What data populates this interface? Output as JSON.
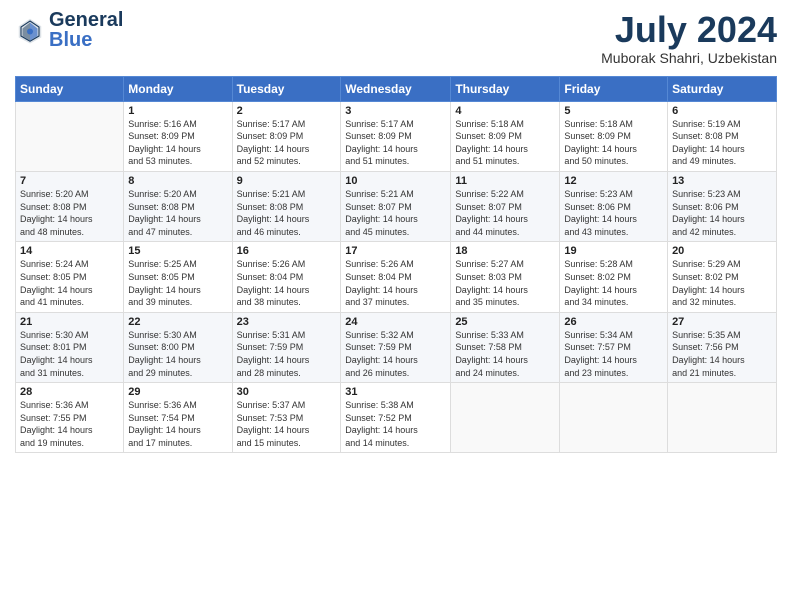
{
  "logo": {
    "text_general": "General",
    "text_blue": "Blue"
  },
  "header": {
    "month_year": "July 2024",
    "location": "Muborak Shahri, Uzbekistan"
  },
  "weekdays": [
    "Sunday",
    "Monday",
    "Tuesday",
    "Wednesday",
    "Thursday",
    "Friday",
    "Saturday"
  ],
  "weeks": [
    [
      {
        "day": "",
        "info": ""
      },
      {
        "day": "1",
        "info": "Sunrise: 5:16 AM\nSunset: 8:09 PM\nDaylight: 14 hours\nand 53 minutes."
      },
      {
        "day": "2",
        "info": "Sunrise: 5:17 AM\nSunset: 8:09 PM\nDaylight: 14 hours\nand 52 minutes."
      },
      {
        "day": "3",
        "info": "Sunrise: 5:17 AM\nSunset: 8:09 PM\nDaylight: 14 hours\nand 51 minutes."
      },
      {
        "day": "4",
        "info": "Sunrise: 5:18 AM\nSunset: 8:09 PM\nDaylight: 14 hours\nand 51 minutes."
      },
      {
        "day": "5",
        "info": "Sunrise: 5:18 AM\nSunset: 8:09 PM\nDaylight: 14 hours\nand 50 minutes."
      },
      {
        "day": "6",
        "info": "Sunrise: 5:19 AM\nSunset: 8:08 PM\nDaylight: 14 hours\nand 49 minutes."
      }
    ],
    [
      {
        "day": "7",
        "info": "Sunrise: 5:20 AM\nSunset: 8:08 PM\nDaylight: 14 hours\nand 48 minutes."
      },
      {
        "day": "8",
        "info": "Sunrise: 5:20 AM\nSunset: 8:08 PM\nDaylight: 14 hours\nand 47 minutes."
      },
      {
        "day": "9",
        "info": "Sunrise: 5:21 AM\nSunset: 8:08 PM\nDaylight: 14 hours\nand 46 minutes."
      },
      {
        "day": "10",
        "info": "Sunrise: 5:21 AM\nSunset: 8:07 PM\nDaylight: 14 hours\nand 45 minutes."
      },
      {
        "day": "11",
        "info": "Sunrise: 5:22 AM\nSunset: 8:07 PM\nDaylight: 14 hours\nand 44 minutes."
      },
      {
        "day": "12",
        "info": "Sunrise: 5:23 AM\nSunset: 8:06 PM\nDaylight: 14 hours\nand 43 minutes."
      },
      {
        "day": "13",
        "info": "Sunrise: 5:23 AM\nSunset: 8:06 PM\nDaylight: 14 hours\nand 42 minutes."
      }
    ],
    [
      {
        "day": "14",
        "info": "Sunrise: 5:24 AM\nSunset: 8:05 PM\nDaylight: 14 hours\nand 41 minutes."
      },
      {
        "day": "15",
        "info": "Sunrise: 5:25 AM\nSunset: 8:05 PM\nDaylight: 14 hours\nand 39 minutes."
      },
      {
        "day": "16",
        "info": "Sunrise: 5:26 AM\nSunset: 8:04 PM\nDaylight: 14 hours\nand 38 minutes."
      },
      {
        "day": "17",
        "info": "Sunrise: 5:26 AM\nSunset: 8:04 PM\nDaylight: 14 hours\nand 37 minutes."
      },
      {
        "day": "18",
        "info": "Sunrise: 5:27 AM\nSunset: 8:03 PM\nDaylight: 14 hours\nand 35 minutes."
      },
      {
        "day": "19",
        "info": "Sunrise: 5:28 AM\nSunset: 8:02 PM\nDaylight: 14 hours\nand 34 minutes."
      },
      {
        "day": "20",
        "info": "Sunrise: 5:29 AM\nSunset: 8:02 PM\nDaylight: 14 hours\nand 32 minutes."
      }
    ],
    [
      {
        "day": "21",
        "info": "Sunrise: 5:30 AM\nSunset: 8:01 PM\nDaylight: 14 hours\nand 31 minutes."
      },
      {
        "day": "22",
        "info": "Sunrise: 5:30 AM\nSunset: 8:00 PM\nDaylight: 14 hours\nand 29 minutes."
      },
      {
        "day": "23",
        "info": "Sunrise: 5:31 AM\nSunset: 7:59 PM\nDaylight: 14 hours\nand 28 minutes."
      },
      {
        "day": "24",
        "info": "Sunrise: 5:32 AM\nSunset: 7:59 PM\nDaylight: 14 hours\nand 26 minutes."
      },
      {
        "day": "25",
        "info": "Sunrise: 5:33 AM\nSunset: 7:58 PM\nDaylight: 14 hours\nand 24 minutes."
      },
      {
        "day": "26",
        "info": "Sunrise: 5:34 AM\nSunset: 7:57 PM\nDaylight: 14 hours\nand 23 minutes."
      },
      {
        "day": "27",
        "info": "Sunrise: 5:35 AM\nSunset: 7:56 PM\nDaylight: 14 hours\nand 21 minutes."
      }
    ],
    [
      {
        "day": "28",
        "info": "Sunrise: 5:36 AM\nSunset: 7:55 PM\nDaylight: 14 hours\nand 19 minutes."
      },
      {
        "day": "29",
        "info": "Sunrise: 5:36 AM\nSunset: 7:54 PM\nDaylight: 14 hours\nand 17 minutes."
      },
      {
        "day": "30",
        "info": "Sunrise: 5:37 AM\nSunset: 7:53 PM\nDaylight: 14 hours\nand 15 minutes."
      },
      {
        "day": "31",
        "info": "Sunrise: 5:38 AM\nSunset: 7:52 PM\nDaylight: 14 hours\nand 14 minutes."
      },
      {
        "day": "",
        "info": ""
      },
      {
        "day": "",
        "info": ""
      },
      {
        "day": "",
        "info": ""
      }
    ]
  ]
}
